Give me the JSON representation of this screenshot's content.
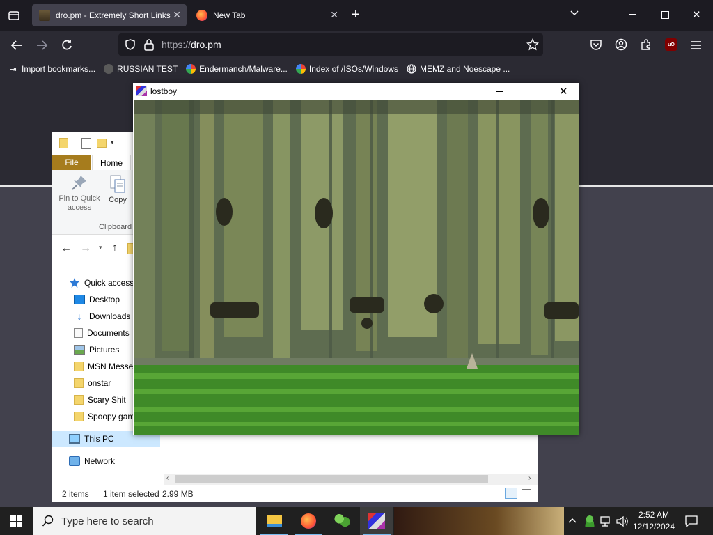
{
  "browser": {
    "tabs": [
      {
        "title": "dro.pm - Extremely Short Links",
        "active": true
      },
      {
        "title": "New Tab",
        "active": false
      }
    ],
    "url_scheme": "https://",
    "url_host": "dro.pm",
    "bookmarks": [
      {
        "label": "Import bookmarks...",
        "icon": "import-icon"
      },
      {
        "label": "RUSSIAN TEST",
        "icon": "bookmark-favicon"
      },
      {
        "label": "Endermanch/Malware...",
        "icon": "google-icon"
      },
      {
        "label": "Index of /ISOs/Windows",
        "icon": "google-icon"
      },
      {
        "label": "MEMZ and Noescape ...",
        "icon": "globe-icon"
      }
    ]
  },
  "explorer": {
    "ribbon_tabs": [
      "File",
      "Home"
    ],
    "pin_label": "Pin to Quick access",
    "copy_label": "Copy",
    "group_label": "Clipboard",
    "nav": [
      {
        "label": "Quick access",
        "icon": "star-icon"
      },
      {
        "label": "Desktop",
        "icon": "desktop-icon"
      },
      {
        "label": "Downloads",
        "icon": "download-icon"
      },
      {
        "label": "Documents",
        "icon": "document-icon"
      },
      {
        "label": "Pictures",
        "icon": "pictures-icon"
      },
      {
        "label": "MSN Messe",
        "icon": "folder-icon"
      },
      {
        "label": "onstar",
        "icon": "folder-icon"
      },
      {
        "label": "Scary Shit",
        "icon": "folder-icon"
      },
      {
        "label": "Spoopy gam",
        "icon": "folder-icon"
      },
      {
        "label": "This PC",
        "icon": "pc-icon"
      },
      {
        "label": "Network",
        "icon": "network-icon"
      }
    ],
    "status": {
      "items": "2 items",
      "selected": "1 item selected",
      "size": "2.99 MB"
    }
  },
  "game_window": {
    "title": "lostboy"
  },
  "taskbar": {
    "search_placeholder": "Type here to search",
    "time": "2:52 AM",
    "date": "12/12/2024"
  },
  "colors": {
    "taskbar_bg": "#202020",
    "browser_bg": "#2b2a33",
    "tab_active": "#42414d"
  }
}
